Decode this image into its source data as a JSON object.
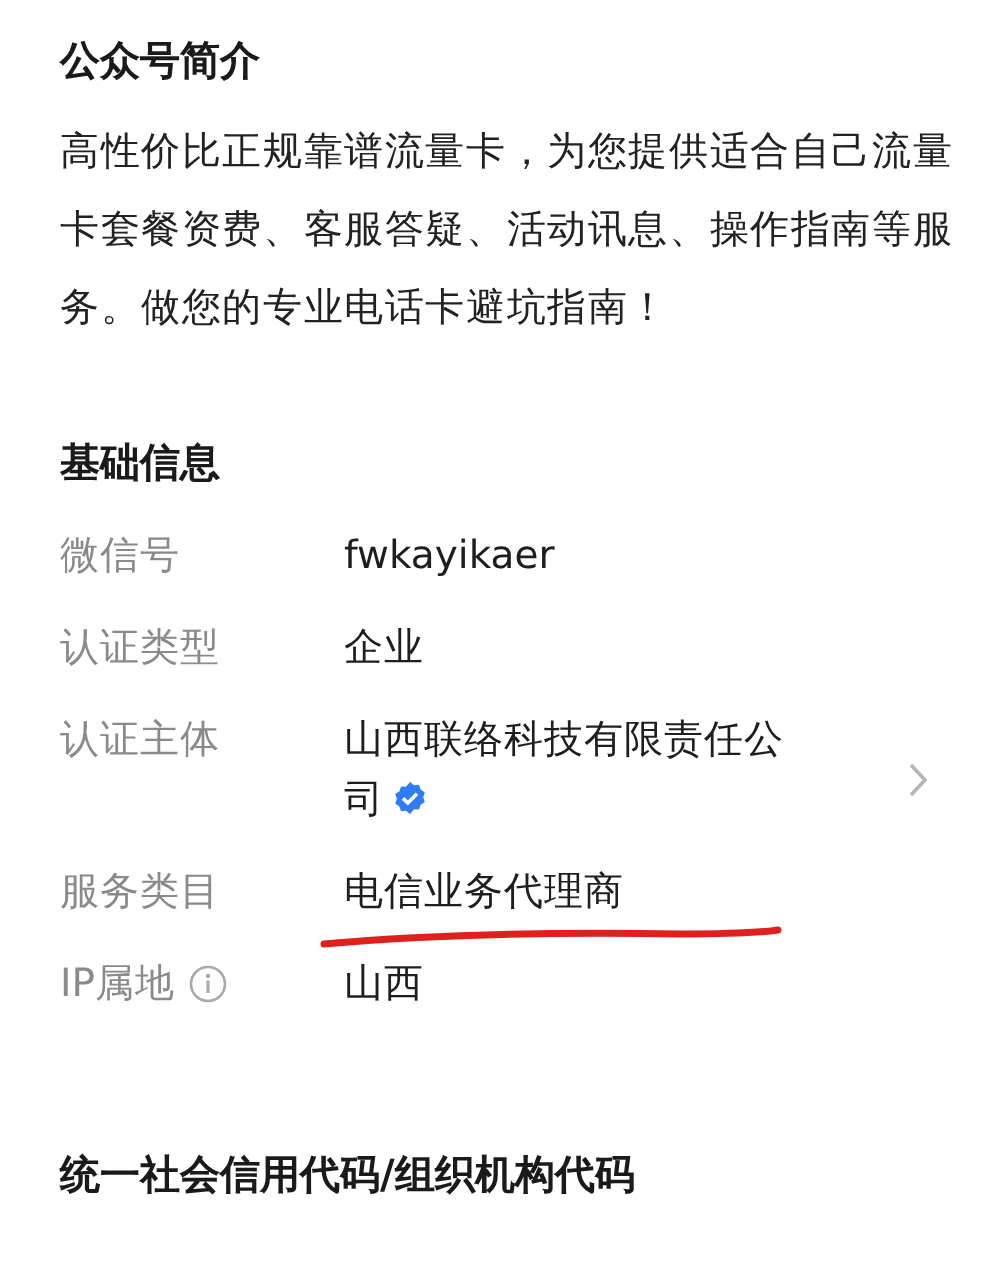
{
  "intro": {
    "heading": "公众号简介",
    "text": "高性价比正规靠谱流量卡，为您提供适合自己流量卡套餐资费、客服答疑、活动讯息、操作指南等服务。做您的专业电话卡避坑指南！"
  },
  "basic_info": {
    "heading": "基础信息",
    "rows": [
      {
        "label": "微信号",
        "value": "fwkayikaer"
      },
      {
        "label": "认证类型",
        "value": "企业"
      },
      {
        "label": "认证主体",
        "value": "山西联络科技有限责任公司",
        "verified": true,
        "chevron": true
      },
      {
        "label": "服务类目",
        "value": "电信业务代理商",
        "underlined": true
      },
      {
        "label": "IP属地",
        "value": "山西",
        "info": true
      }
    ]
  },
  "credit_code": {
    "heading": "统一社会信用代码/组织机构代码"
  }
}
